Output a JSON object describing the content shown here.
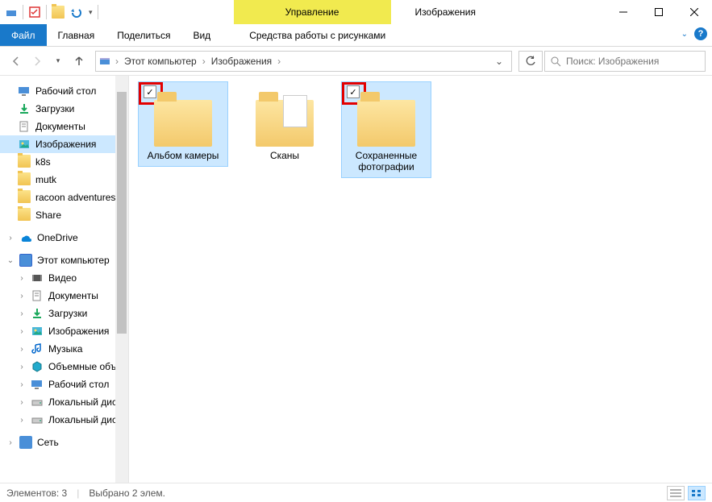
{
  "window": {
    "title": "Изображения",
    "context_tab": "Управление",
    "context_subtitle": "Средства работы с рисунками"
  },
  "tabs": {
    "file": "Файл",
    "home": "Главная",
    "share": "Поделиться",
    "view": "Вид"
  },
  "nav": {
    "crumb_root": "Этот компьютер",
    "crumb_current": "Изображения"
  },
  "search": {
    "placeholder": "Поиск: Изображения"
  },
  "sidebar": {
    "quick": [
      {
        "label": "Рабочий стол",
        "pinned": true,
        "icon": "monitor"
      },
      {
        "label": "Загрузки",
        "pinned": true,
        "icon": "download"
      },
      {
        "label": "Документы",
        "pinned": true,
        "icon": "doc"
      },
      {
        "label": "Изображения",
        "pinned": true,
        "icon": "pic",
        "selected": true
      },
      {
        "label": "k8s",
        "icon": "folder"
      },
      {
        "label": "mutk",
        "icon": "folder"
      },
      {
        "label": "racoon adventures",
        "icon": "folder"
      },
      {
        "label": "Share",
        "icon": "folder"
      }
    ],
    "onedrive": "OneDrive",
    "thispc_root": "Этот компьютер",
    "thispc": [
      {
        "label": "Видео",
        "icon": "video"
      },
      {
        "label": "Документы",
        "icon": "doc"
      },
      {
        "label": "Загрузки",
        "icon": "download"
      },
      {
        "label": "Изображения",
        "icon": "pic"
      },
      {
        "label": "Музыка",
        "icon": "music"
      },
      {
        "label": "Объемные объе",
        "icon": "cube"
      },
      {
        "label": "Рабочий стол",
        "icon": "monitor"
      },
      {
        "label": "Локальный диск",
        "icon": "drive"
      },
      {
        "label": "Локальный диск",
        "icon": "drive"
      }
    ],
    "network": "Сеть"
  },
  "folders": [
    {
      "name": "Альбом камеры",
      "selected": true,
      "checked": true,
      "highlight": true
    },
    {
      "name": "Сканы",
      "selected": false,
      "checked": false,
      "highlight": false
    },
    {
      "name": "Сохраненные фотографии",
      "selected": true,
      "checked": true,
      "highlight": true
    }
  ],
  "status": {
    "count": "Элементов: 3",
    "selected": "Выбрано 2 элем."
  }
}
